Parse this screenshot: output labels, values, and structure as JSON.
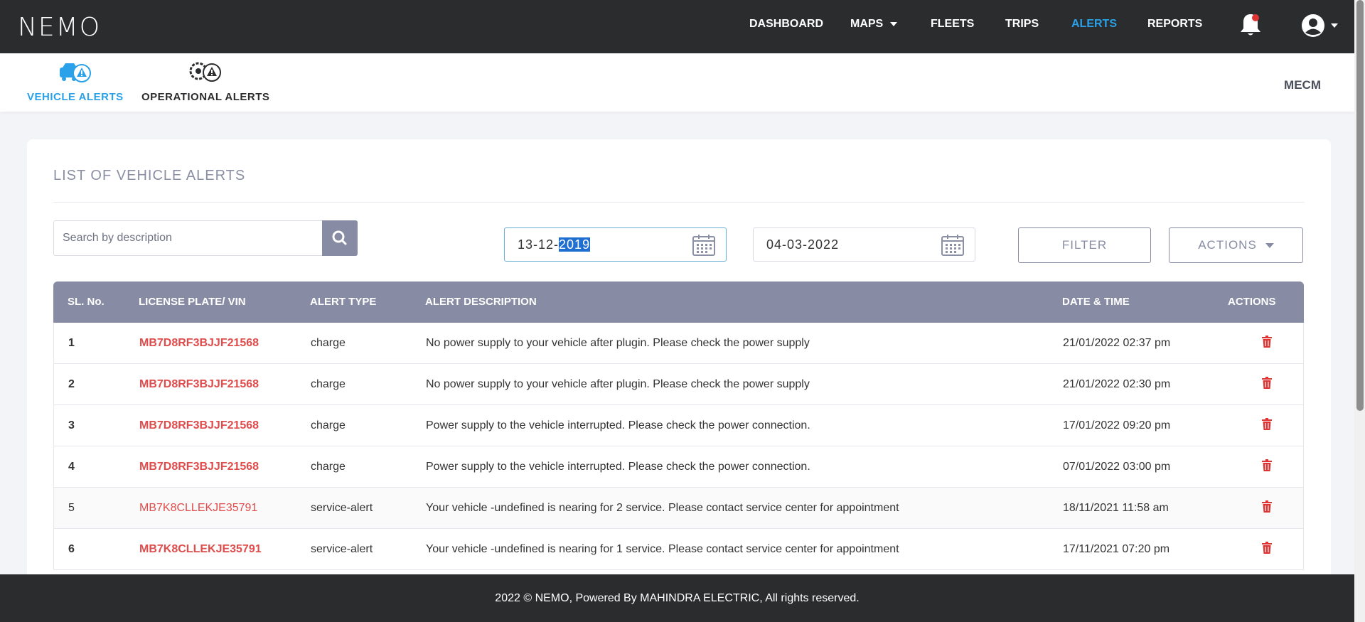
{
  "brand": {
    "logo": "NEMO"
  },
  "nav": {
    "items": [
      {
        "label": "DASHBOARD",
        "active": false
      },
      {
        "label": "MAPS",
        "active": false,
        "dropdown": true
      },
      {
        "label": "FLEETS",
        "active": false
      },
      {
        "label": "TRIPS",
        "active": false
      },
      {
        "label": "ALERTS",
        "active": true
      },
      {
        "label": "REPORTS",
        "active": false
      }
    ],
    "icons": [
      "bell-icon",
      "user-account-icon"
    ],
    "notification_dot_color": "#e03434"
  },
  "subnav": {
    "tabs": [
      {
        "label": "VEHICLE ALERTS",
        "icon": "vehicle-alert-icon",
        "active": true
      },
      {
        "label": "OPERATIONAL ALERTS",
        "icon": "operational-alert-icon",
        "active": false
      }
    ],
    "org": "MECM"
  },
  "card": {
    "title": "LIST OF VEHICLE ALERTS",
    "search": {
      "placeholder": "Search by description",
      "value": ""
    },
    "date_from": {
      "prefix": "13-12-",
      "selected": "2019"
    },
    "date_to": "04-03-2022",
    "filter_label": "FILTER",
    "actions_label": "ACTIONS"
  },
  "table": {
    "headers": [
      "SL. No.",
      "LICENSE PLATE/ VIN",
      "ALERT TYPE",
      "ALERT DESCRIPTION",
      "DATE & TIME",
      "ACTIONS"
    ],
    "rows": [
      {
        "sl": "1",
        "plate": "MB7D8RF3BJJF21568",
        "type": "charge",
        "desc": "No power supply to your vehicle after plugin. Please check the power supply",
        "datetime": "21/01/2022 02:37 pm"
      },
      {
        "sl": "2",
        "plate": "MB7D8RF3BJJF21568",
        "type": "charge",
        "desc": "No power supply to your vehicle after plugin. Please check the power supply",
        "datetime": "21/01/2022 02:30 pm"
      },
      {
        "sl": "3",
        "plate": "MB7D8RF3BJJF21568",
        "type": "charge",
        "desc": "Power supply to the vehicle interrupted. Please check the power connection.",
        "datetime": "17/01/2022 09:20 pm"
      },
      {
        "sl": "4",
        "plate": "MB7D8RF3BJJF21568",
        "type": "charge",
        "desc": "Power supply to the vehicle interrupted. Please check the power connection.",
        "datetime": "07/01/2022 03:00 pm"
      },
      {
        "sl": "5",
        "plate": "MB7K8CLLEKJE35791",
        "type": "service-alert",
        "desc": "Your vehicle -undefined is nearing for 2 service. Please contact service center for appointment",
        "datetime": "18/11/2021 11:58 am"
      },
      {
        "sl": "6",
        "plate": "MB7K8CLLEKJE35791",
        "type": "service-alert",
        "desc": "Your vehicle -undefined is nearing for 1 service. Please contact service center for appointment",
        "datetime": "17/11/2021 07:20 pm"
      }
    ]
  },
  "footer": {
    "text": "2022 © NEMO, Powered By MAHINDRA ELECTRIC, All rights reserved."
  },
  "colors": {
    "accent": "#2aa1e8",
    "plate": "#e04b4b",
    "header": "#878ca4",
    "dark": "#2b2c2e"
  }
}
